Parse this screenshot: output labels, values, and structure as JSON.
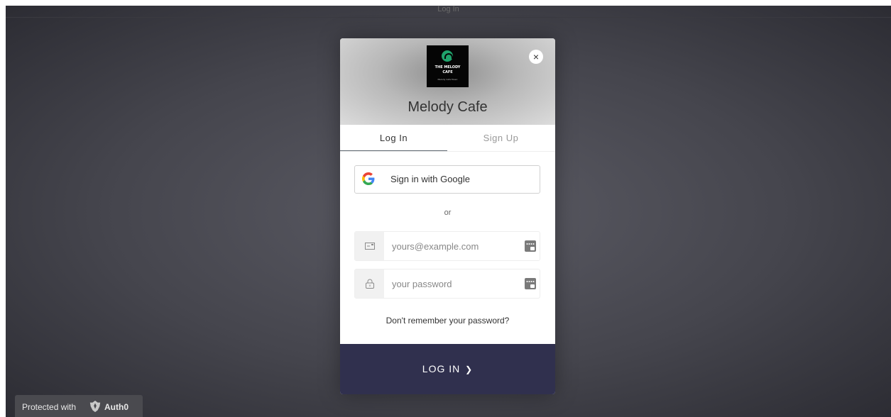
{
  "window": {
    "title": "Log In"
  },
  "widget": {
    "app_name": "Melody Cafe",
    "logo": {
      "line1": "THE MELODY",
      "line2": "CAFE",
      "line3": "Melody Cafe Music"
    },
    "close_icon": "×",
    "tabs": [
      {
        "label": "Log In",
        "active": true
      },
      {
        "label": "Sign Up",
        "active": false
      }
    ],
    "google_button": {
      "label": "Sign in with Google"
    },
    "separator": "or",
    "email": {
      "placeholder": "yours@example.com",
      "icon": "envelope-icon"
    },
    "password": {
      "placeholder": "your password",
      "icon": "lock-icon"
    },
    "forgot_link": "Don't remember your password?",
    "submit": {
      "label": "LOG IN",
      "arrow": "❯"
    }
  },
  "footer_badge": {
    "text": "Protected with",
    "brand": "Auth0"
  },
  "colors": {
    "submit_bg": "#30304e",
    "google_blue": "#4285F4",
    "google_red": "#EA4335",
    "google_yellow": "#FBBC05",
    "google_green": "#34A853",
    "logo_disc": "#1fa36b"
  }
}
